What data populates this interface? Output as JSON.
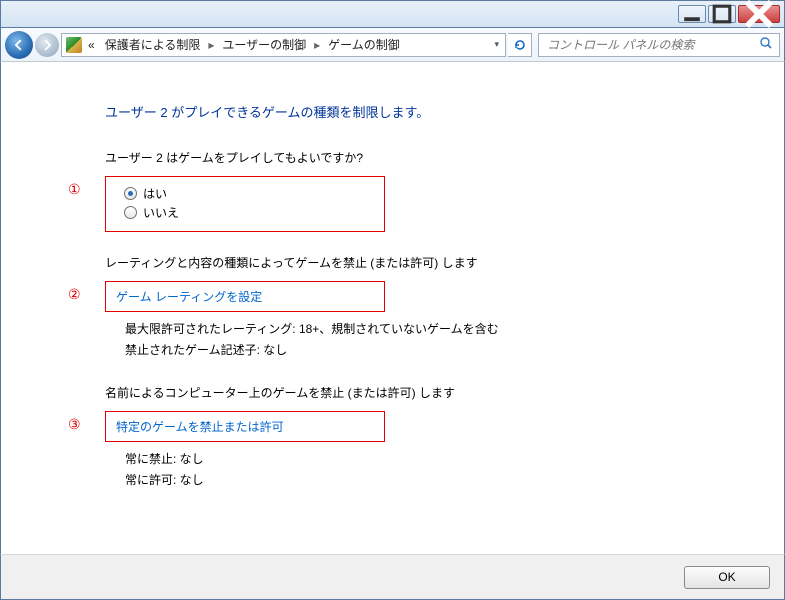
{
  "titlebar": {},
  "nav": {
    "prefix": "«",
    "seg1": "保護者による制限",
    "seg2": "ユーザーの制御",
    "seg3": "ゲームの制御",
    "search_placeholder": "コントロール パネルの検索"
  },
  "page": {
    "title": "ユーザー 2 がプレイできるゲームの種類を制限します。",
    "q1_lead": "ユーザー 2 はゲームをプレイしてもよいですか?",
    "q1_num": "①",
    "q1_yes": "はい",
    "q1_no": "いいえ",
    "q2_lead": "レーティングと内容の種類によってゲームを禁止 (または許可) します",
    "q2_num": "②",
    "q2_link": "ゲーム レーティングを設定",
    "q2_detail1": "最大限許可されたレーティング: 18+、規制されていないゲームを含む",
    "q2_detail2": "禁止されたゲーム記述子: なし",
    "q3_lead": "名前によるコンピューター上のゲームを禁止 (または許可) します",
    "q3_num": "③",
    "q3_link": "特定のゲームを禁止または許可",
    "q3_detail1": "常に禁止: なし",
    "q3_detail2": "常に許可: なし"
  },
  "footer": {
    "ok": "OK"
  }
}
